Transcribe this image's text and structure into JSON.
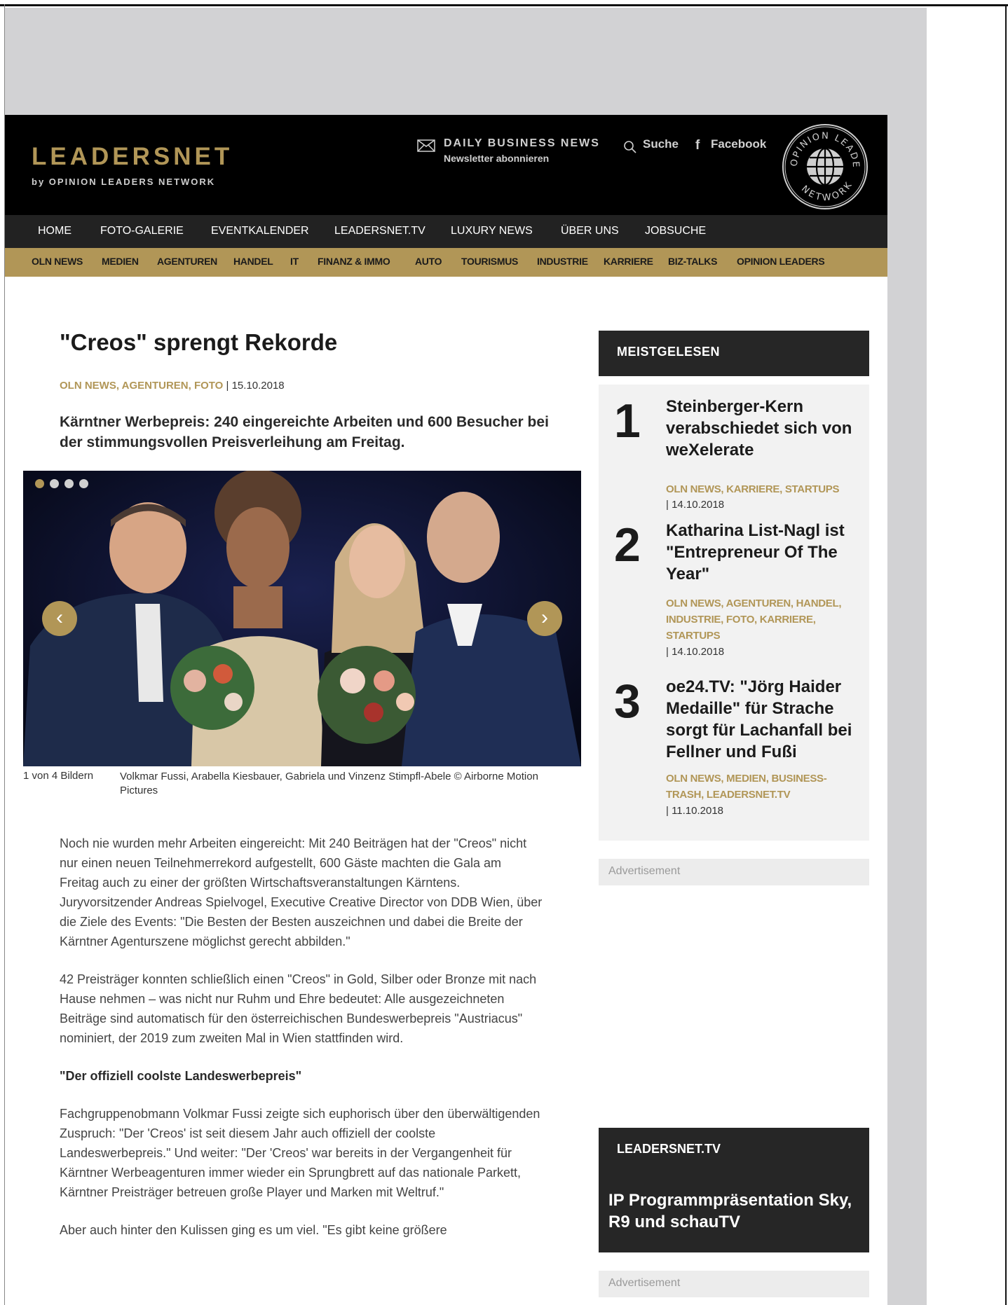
{
  "header": {
    "logo": "LEADERSNET",
    "logo_sub": "by OPINION LEADERS NETWORK",
    "newsletter_title": "DAILY BUSINESS NEWS",
    "newsletter_sub": "Newsletter abonnieren",
    "search_label": "Suche",
    "facebook_label": "Facebook",
    "seal_text": "OPINION LEADERS NETWORK"
  },
  "main_nav": [
    "HOME",
    "FOTO-GALERIE",
    "EVENTKALENDER",
    "LEADERSNET.TV",
    "LUXURY NEWS",
    "ÜBER UNS",
    "JOBSUCHE"
  ],
  "sub_nav": [
    "OLN NEWS",
    "MEDIEN",
    "AGENTUREN",
    "HANDEL",
    "IT",
    "FINANZ & IMMO",
    "AUTO",
    "TOURISMUS",
    "INDUSTRIE",
    "KARRIERE",
    "BIZ-TALKS",
    "OPINION LEADERS"
  ],
  "article": {
    "title": "\"Creos\" sprengt Rekorde",
    "categories": "OLN NEWS, AGENTUREN, FOTO",
    "date": "| 15.10.2018",
    "lead": "Kärntner Werbepreis: 240 eingereichte Arbeiten und 600 Besucher bei der stimmungsvollen Preisverleihung am Freitag.",
    "gallery": {
      "count": "1 von 4 Bildern",
      "caption": "Volkmar Fussi, Arabella Kiesbauer, Gabriela und Vinzenz Stimpfl-Abele © Airborne Motion Pictures",
      "prev": "‹",
      "next": "›"
    },
    "paragraphs": [
      "Noch nie wurden mehr Arbeiten eingereicht: Mit 240 Beiträgen hat der \"Creos\" nicht nur einen neuen Teilnehmerrekord aufgestellt, 600 Gäste machten die Gala am Freitag auch zu einer der größten Wirtschaftsveranstaltungen Kärntens. Juryvorsitzender Andreas Spielvogel, Executive Creative Director von DDB Wien, über die Ziele des Events: \"Die Besten der Besten auszeichnen und dabei die Breite der Kärntner Agenturszene möglichst gerecht abbilden.\"",
      "42 Preisträger konnten schließlich einen \"Creos\" in Gold, Silber oder Bronze mit nach Hause nehmen – was nicht nur Ruhm und Ehre bedeutet: Alle ausgezeichneten Beiträge sind automatisch für den österreichischen Bundeswerbepreis \"Austriacus\" nominiert, der 2019 zum zweiten Mal in Wien stattfinden wird.",
      "\"Der offiziell coolste Landeswerbepreis\"",
      "Fachgruppenobmann Volkmar Fussi zeigte sich euphorisch über den überwältigenden Zuspruch: \"Der 'Creos' ist seit diesem Jahr auch offiziell der coolste Landeswerbepreis.\" Und weiter: \"Der 'Creos' war bereits in der Vergangenheit für Kärntner Werbeagenturen immer wieder ein Sprungbrett auf das nationale Parkett, Kärntner Preisträger betreuen große Player und Marken mit Weltruf.\"",
      "Aber auch hinter den Kulissen ging es um viel. \"Es gibt keine größere"
    ]
  },
  "sidebar": {
    "most_read_title": "MEISTGELESEN",
    "items": [
      {
        "num": "1",
        "title": "Steinberger-Kern verabschiedet sich von weXelerate",
        "cats": "OLN NEWS, KARRIERE, STARTUPS",
        "date": "| 14.10.2018"
      },
      {
        "num": "2",
        "title": "Katharina List-Nagl ist \"Entrepreneur Of The Year\"",
        "cats": "OLN NEWS, AGENTUREN, HANDEL, INDUSTRIE, FOTO, KARRIERE, STARTUPS",
        "date": "| 14.10.2018"
      },
      {
        "num": "3",
        "title": "oe24.TV: \"Jörg Haider Medaille\" für Strache sorgt für Lachanfall bei Fellner und Fußi",
        "cats": "OLN NEWS, MEDIEN, BUSINESS-TRASH, LEADERSNET.TV",
        "date": "| 11.10.2018"
      }
    ],
    "ad_label": "Advertisement",
    "tv_label": "LEADERSNET.TV",
    "tv_title": "IP Programmpräsentation Sky, R9 und schauTV"
  },
  "colors": {
    "accent": "#b19657",
    "header_bg": "#000000",
    "nav_bg": "#222222"
  },
  "icons": [
    "envelope-icon",
    "search-icon",
    "facebook-icon",
    "opinion-leaders-seal",
    "arrow-left-icon",
    "arrow-right-icon"
  ]
}
